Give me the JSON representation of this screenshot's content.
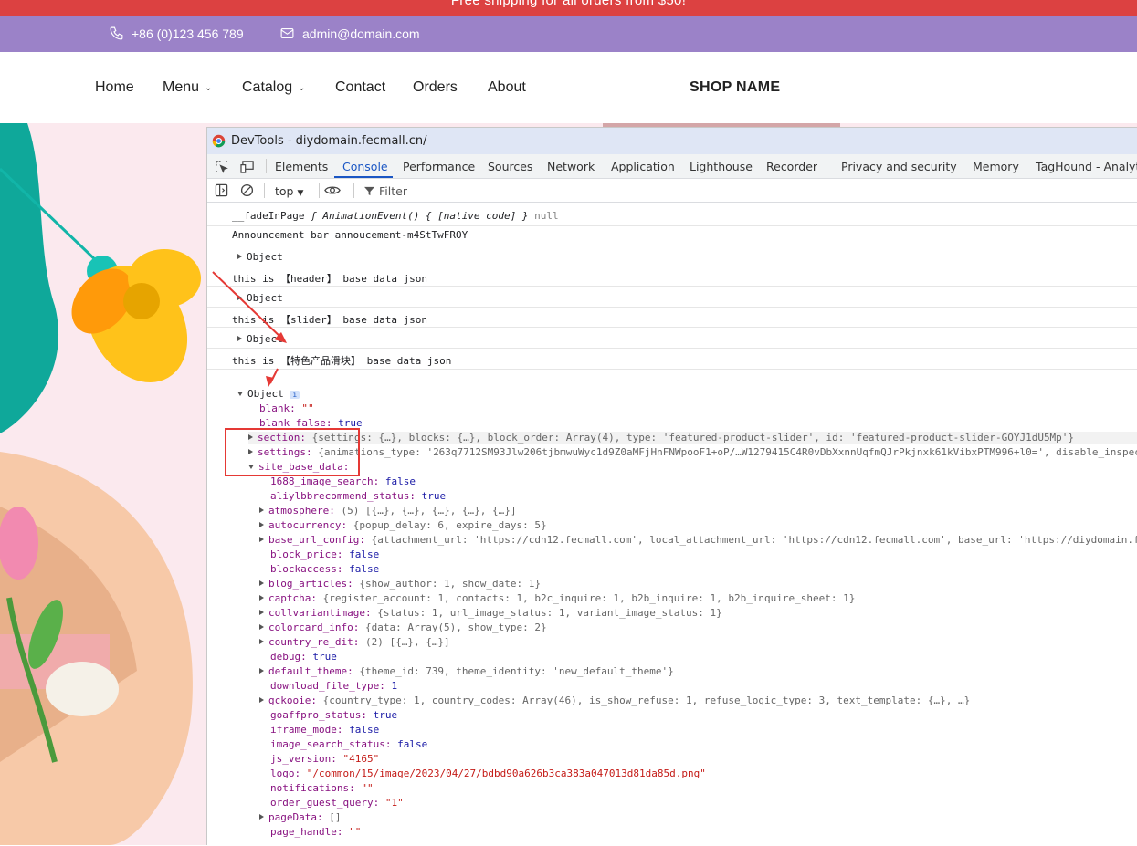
{
  "announcement": "Free shipping for all orders from $50!",
  "topbar": {
    "phone": "+86 (0)123 456 789",
    "email": "admin@domain.com"
  },
  "nav": {
    "items": [
      "Home",
      "Menu",
      "Catalog",
      "Contact",
      "Orders",
      "About"
    ],
    "shop_name": "SHOP NAME"
  },
  "devtools": {
    "title": "DevTools - diydomain.fecmall.cn/",
    "tabs": [
      "Elements",
      "Console",
      "Performance",
      "Sources",
      "Network",
      "Application",
      "Lighthouse",
      "Recorder",
      "Privacy and security",
      "Memory",
      "TagHound - Analyti"
    ],
    "active_tab": "Console",
    "context": "top",
    "filter_placeholder": "Filter",
    "logs": {
      "fade_key": "__fadeInPage",
      "fade_val": "ƒ AnimationEvent() { [native code] }",
      "fade_null": "null",
      "announce": "Announcement bar annoucement-m4StTwFROY",
      "object": "Object",
      "header": "this is 【header】 base data json",
      "slider": "this is 【slider】 base data json",
      "featured": "this is 【特色产品滑块】 base data json"
    },
    "tree": {
      "root": "Object",
      "info_badge": "i",
      "blank_key": "blank:",
      "blank_val": "\"\"",
      "blank_false_key": "blank_false:",
      "blank_false_val": "true",
      "section_key": "section:",
      "section_val": "{settings: {…}, blocks: {…}, block_order: Array(4), type: 'featured-product-slider', id: 'featured-product-slider-GOYJ1dU5Mp'}",
      "settings_key": "settings:",
      "settings_val": "{animations_type: '263q7712SM93Jlw206tjbmwuWyc1d9Z0aMFjHnFNWpooF1+oP/…W1279415C4R0vDbXxnnUqfmQJrPkjnxk61kVibxPTM996+l0=', disable_inspect",
      "sbd_key": "site_base_data:",
      "entries": [
        {
          "k": "1688_image_search:",
          "v": "false",
          "t": "bool",
          "exp": false
        },
        {
          "k": "aliylbbrecommend_status:",
          "v": "true",
          "t": "bool",
          "exp": false
        },
        {
          "k": "atmosphere:",
          "v": "(5) [{…}, {…}, {…}, {…}, {…}]",
          "t": "plain",
          "exp": true
        },
        {
          "k": "autocurrency:",
          "v": "{popup_delay: 6, expire_days: 5}",
          "t": "plain",
          "exp": true
        },
        {
          "k": "base_url_config:",
          "v": "{attachment_url: 'https://cdn12.fecmall.com', local_attachment_url: 'https://cdn12.fecmall.com', base_url: 'https://diydomain.f",
          "t": "plain",
          "exp": true
        },
        {
          "k": "block_price:",
          "v": "false",
          "t": "bool",
          "exp": false
        },
        {
          "k": "blockaccess:",
          "v": "false",
          "t": "bool",
          "exp": false
        },
        {
          "k": "blog_articles:",
          "v": "{show_author: 1, show_date: 1}",
          "t": "plain",
          "exp": true
        },
        {
          "k": "captcha:",
          "v": "{register_account: 1, contacts: 1, b2c_inquire: 1, b2b_inquire: 1, b2b_inquire_sheet: 1}",
          "t": "plain",
          "exp": true
        },
        {
          "k": "collvariantimage:",
          "v": "{status: 1, url_image_status: 1, variant_image_status: 1}",
          "t": "plain",
          "exp": true
        },
        {
          "k": "colorcard_info:",
          "v": "{data: Array(5), show_type: 2}",
          "t": "plain",
          "exp": true
        },
        {
          "k": "country_re_dit:",
          "v": "(2) [{…}, {…}]",
          "t": "plain",
          "exp": true
        },
        {
          "k": "debug:",
          "v": "true",
          "t": "bool",
          "exp": false
        },
        {
          "k": "default_theme:",
          "v": "{theme_id: 739, theme_identity: 'new_default_theme'}",
          "t": "plain",
          "exp": true
        },
        {
          "k": "download_file_type:",
          "v": "1",
          "t": "num",
          "exp": false
        },
        {
          "k": "gckooie:",
          "v": "{country_type: 1, country_codes: Array(46), is_show_refuse: 1, refuse_logic_type: 3, text_template: {…}, …}",
          "t": "plain",
          "exp": true
        },
        {
          "k": "goaffpro_status:",
          "v": "true",
          "t": "bool",
          "exp": false
        },
        {
          "k": "iframe_mode:",
          "v": "false",
          "t": "bool",
          "exp": false
        },
        {
          "k": "image_search_status:",
          "v": "false",
          "t": "bool",
          "exp": false
        },
        {
          "k": "js_version:",
          "v": "\"4165\"",
          "t": "str",
          "exp": false
        },
        {
          "k": "logo:",
          "v": "\"/common/15/image/2023/04/27/bdbd90a626b3ca383a047013d81da85d.png\"",
          "t": "str",
          "exp": false
        },
        {
          "k": "notifications:",
          "v": "\"\"",
          "t": "str",
          "exp": false
        },
        {
          "k": "order_guest_query:",
          "v": "\"1\"",
          "t": "str",
          "exp": false
        },
        {
          "k": "pageData:",
          "v": "[]",
          "t": "plain",
          "exp": true
        },
        {
          "k": "page_handle:",
          "v": "\"\"",
          "t": "str",
          "exp": false
        }
      ]
    }
  },
  "colors": {
    "announce_bg": "#dc4141",
    "topbar_bg": "#9b82c8",
    "highlight": "#e53935",
    "active_tab": "#1a56c4"
  }
}
